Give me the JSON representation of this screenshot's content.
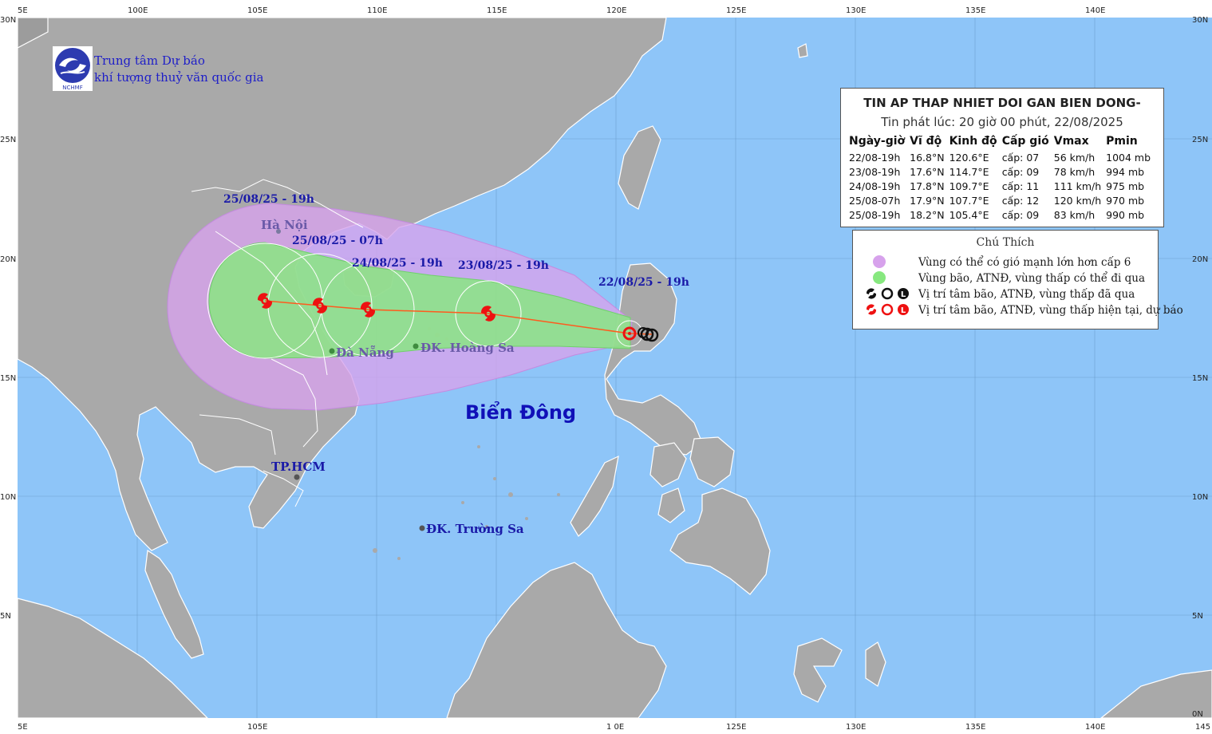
{
  "org": {
    "line1": "Trung tâm Dự báo",
    "line2": "khí tượng thuỷ văn quốc gia",
    "logo_text": "NCHMF"
  },
  "frame": {
    "top_ticks": [
      "5E",
      "100E",
      "105E",
      "110E",
      "115E",
      "120E",
      "125E",
      "130E",
      "135E",
      "140E"
    ],
    "bottom_ticks": [
      "5E",
      "105E",
      "1 0E",
      "125E",
      "130E",
      "135E",
      "140E",
      "145"
    ],
    "left_ticks": [
      "30N",
      "25N",
      "20N",
      "15N",
      "10N",
      "5N"
    ],
    "right_ticks": [
      "30N",
      "25N",
      "20N",
      "15N",
      "10N",
      "5N",
      "0N"
    ]
  },
  "info": {
    "title": "TIN AP THAP NHIET DOI GAN BIEN DONG-",
    "issued": "Tin phát lúc: 20 giờ 00 phút, 22/08/2025",
    "headers": [
      "Ngày-giờ",
      "Vĩ độ",
      "Kinh độ",
      "Cấp gió",
      "Vmax",
      "Pmin"
    ],
    "rows": [
      [
        "22/08-19h",
        "16.8°N",
        "120.6°E",
        "cấp: 07",
        "56 km/h",
        "1004 mb"
      ],
      [
        "23/08-19h",
        "17.6°N",
        "114.7°E",
        "cấp: 09",
        "78 km/h",
        "994 mb"
      ],
      [
        "24/08-19h",
        "17.8°N",
        "109.7°E",
        "cấp: 11",
        "111 km/h",
        "975 mb"
      ],
      [
        "25/08-07h",
        "17.9°N",
        "107.7°E",
        "cấp: 12",
        "120 km/h",
        "970 mb"
      ],
      [
        "25/08-19h",
        "18.2°N",
        "105.4°E",
        "cấp: 09",
        "83 km/h",
        "990 mb"
      ]
    ]
  },
  "legend": {
    "title": "Chú Thích",
    "items": [
      "Vùng có thể có gió mạnh lớn hơn cấp 6",
      "Vùng bão, ATNĐ, vùng thấp có thể đi qua",
      "Vị trí tâm bão, ATNĐ, vùng thấp đã qua",
      "Vị trí tâm bão, ATNĐ, vùng thấp hiện tại, dự báo"
    ]
  },
  "track_labels": [
    "25/08/25 - 19h",
    "25/08/25 - 07h",
    "24/08/25 - 19h",
    "23/08/25 - 19h",
    "22/08/25 - 19h"
  ],
  "places": {
    "hanoi": "Hà Nội",
    "danang": "Đà Nẵng",
    "hoangsa": "ĐK. Hoàng Sa",
    "tphcm": "TP.HCM",
    "truongsa": "ĐK. Trường Sa"
  },
  "sea_name": "Biển Đông",
  "colors": {
    "ocean": "#8ec5f8",
    "land": "#a9a9a9",
    "wind_zone": "#d7a2ec",
    "storm_zone": "#87e87f",
    "track": "#ff5a1e",
    "storm_icon": "#ee1111",
    "label_blue": "#1a1aa8"
  }
}
